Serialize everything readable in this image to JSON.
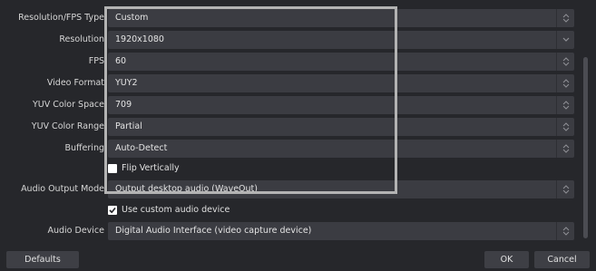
{
  "settings": {
    "resolution_fps_type": {
      "label": "Resolution/FPS Type",
      "value": "Custom"
    },
    "resolution": {
      "label": "Resolution",
      "value": "1920x1080"
    },
    "fps": {
      "label": "FPS",
      "value": "60"
    },
    "video_format": {
      "label": "Video Format",
      "value": "YUY2"
    },
    "yuv_color_space": {
      "label": "YUV Color Space",
      "value": "709"
    },
    "yuv_color_range": {
      "label": "YUV Color Range",
      "value": "Partial"
    },
    "buffering": {
      "label": "Buffering",
      "value": "Auto-Detect"
    },
    "flip_vertically": {
      "label": "Flip Vertically",
      "checked": false
    },
    "audio_output_mode": {
      "label": "Audio Output Mode",
      "value": "Output desktop audio (WaveOut)"
    },
    "use_custom_audio_device": {
      "label": "Use custom audio device",
      "checked": true
    },
    "audio_device": {
      "label": "Audio Device",
      "value": "Digital Audio Interface (video capture device)"
    }
  },
  "buttons": {
    "defaults": "Defaults",
    "ok": "OK",
    "cancel": "Cancel"
  },
  "colors": {
    "background": "#26272b",
    "control": "#3b3c42",
    "button": "#3e3f45",
    "highlight_border": "#b3b3b3",
    "text": "#dcdcdc"
  }
}
